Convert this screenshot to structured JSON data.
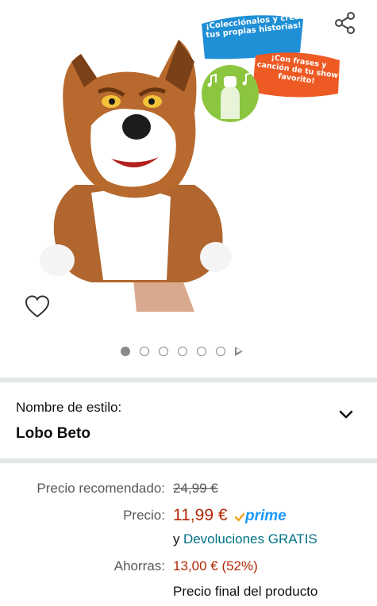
{
  "product": {
    "image_alt": "Marioneta de lobo de peluche",
    "badges": {
      "blue": "¡Colecciónalos y crea tus propias historias!",
      "orange": "¡Con frases y canción de tu show favorito!"
    }
  },
  "gallery": {
    "dot_count": 6,
    "active_index": 0
  },
  "style": {
    "label": "Nombre de estilo:",
    "value": "Lobo Beto"
  },
  "pricing": {
    "recommended_label": "Precio recomendado:",
    "recommended_value": "24,99 €",
    "price_label": "Precio:",
    "price_value": "11,99 €",
    "prime_label": "prime",
    "returns_prefix": "y",
    "returns_link": "Devoluciones GRATIS",
    "savings_label": "Ahorras:",
    "savings_value": "13,00 € (52%)",
    "final_note": "Precio final del producto"
  },
  "colors": {
    "price_red": "#B12704",
    "link_teal": "#007185",
    "prime_blue": "#1A98FF",
    "divider": "#E3E6E6"
  }
}
